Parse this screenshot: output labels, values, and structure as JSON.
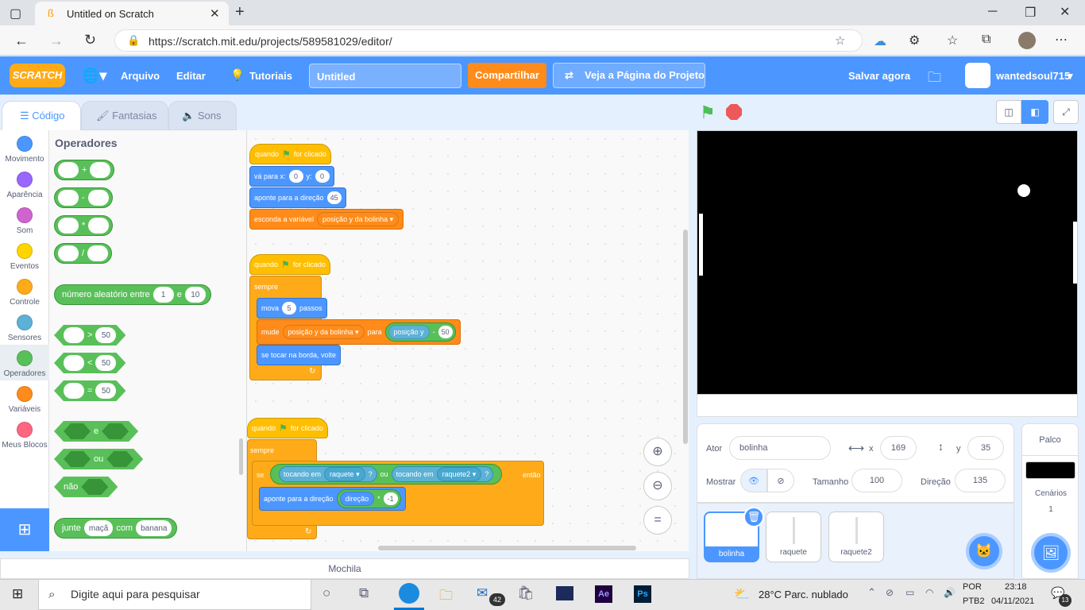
{
  "browser": {
    "tab_title": "Untitled on Scratch",
    "url": "https://scratch.mit.edu/projects/589581029/editor/"
  },
  "menu": {
    "logo": "SCRATCH",
    "file": "Arquivo",
    "edit": "Editar",
    "tutorials": "Tutoriais",
    "title": "Untitled",
    "share": "Compartilhar",
    "see_page": "Veja a Página do Projeto",
    "save_now": "Salvar agora",
    "username": "wantedsoul715"
  },
  "tabs": {
    "code": "Código",
    "costumes": "Fantasias",
    "sounds": "Sons"
  },
  "categories": [
    "Movimento",
    "Aparência",
    "Som",
    "Eventos",
    "Controle",
    "Sensores",
    "Operadores",
    "Variáveis",
    "Meus Blocos"
  ],
  "category_colors": [
    "#4c97ff",
    "#9966ff",
    "#cf63cf",
    "#ffd500",
    "#ffab19",
    "#5cb1d6",
    "#59c059",
    "#ff8c1a",
    "#ff6680"
  ],
  "palette": {
    "heading": "Operadores",
    "plus": "+",
    "minus": "-",
    "times": "*",
    "divide": "/",
    "random_label": "número aleatório entre",
    "random_from": "1",
    "random_and": "e",
    "random_to": "10",
    "gt": ">",
    "lt": "<",
    "eq": "=",
    "cmp_value": "50",
    "and": "e",
    "or": "ou",
    "not": "não",
    "join": "junte",
    "join_a": "maçã",
    "join_with": "com",
    "join_b": "banana"
  },
  "scripts": {
    "s1": {
      "hat": "quando",
      "hat2": "for clicado",
      "goto": "vá para x:",
      "x": "0",
      "y_label": "y:",
      "y": "0",
      "point": "aponte  para a direção",
      "dir": "45",
      "hide": "esconda a variável",
      "var": "posição y da bolinha"
    },
    "s2": {
      "hat": "quando",
      "hat2": "for clicado",
      "forever": "sempre",
      "move": "mova",
      "steps": "5",
      "steps_label": "passos",
      "change": "mude",
      "var": "posição y da bolinha",
      "by": "para",
      "pos": "posição y",
      "op": "-",
      "val": "50",
      "bounce": "se tocar na borda, volte"
    },
    "s3": {
      "hat": "quando",
      "hat2": "for clicado",
      "forever": "sempre",
      "if": "se",
      "touching1": "tocando em",
      "obj1": "raquete",
      "q1": "?",
      "or": "ou",
      "touching2": "tocando em",
      "obj2": "raquete2",
      "q2": "?",
      "then": "então",
      "point": "aponte  para a direção",
      "direction": "direção",
      "times": "*",
      "neg": "-1"
    }
  },
  "backpack": "Mochila",
  "sprite": {
    "actor_label": "Ator",
    "name": "bolinha",
    "x_label": "x",
    "x": "169",
    "y_label": "y",
    "y": "35",
    "show_label": "Mostrar",
    "size_label": "Tamanho",
    "size": "100",
    "dir_label": "Direção",
    "dir": "135"
  },
  "sprites": [
    "bolinha",
    "raquete",
    "raquete2"
  ],
  "stage_panel": {
    "title": "Palco",
    "backdrops_label": "Cenários",
    "backdrops": "1"
  },
  "taskbar": {
    "search": "Digite aqui para pesquisar",
    "weather": "28°C  Parc. nublado",
    "lang1": "POR",
    "lang2": "PTB2",
    "time": "23:18",
    "date": "04/11/2021",
    "mail_badge": "42",
    "notif": "13"
  }
}
